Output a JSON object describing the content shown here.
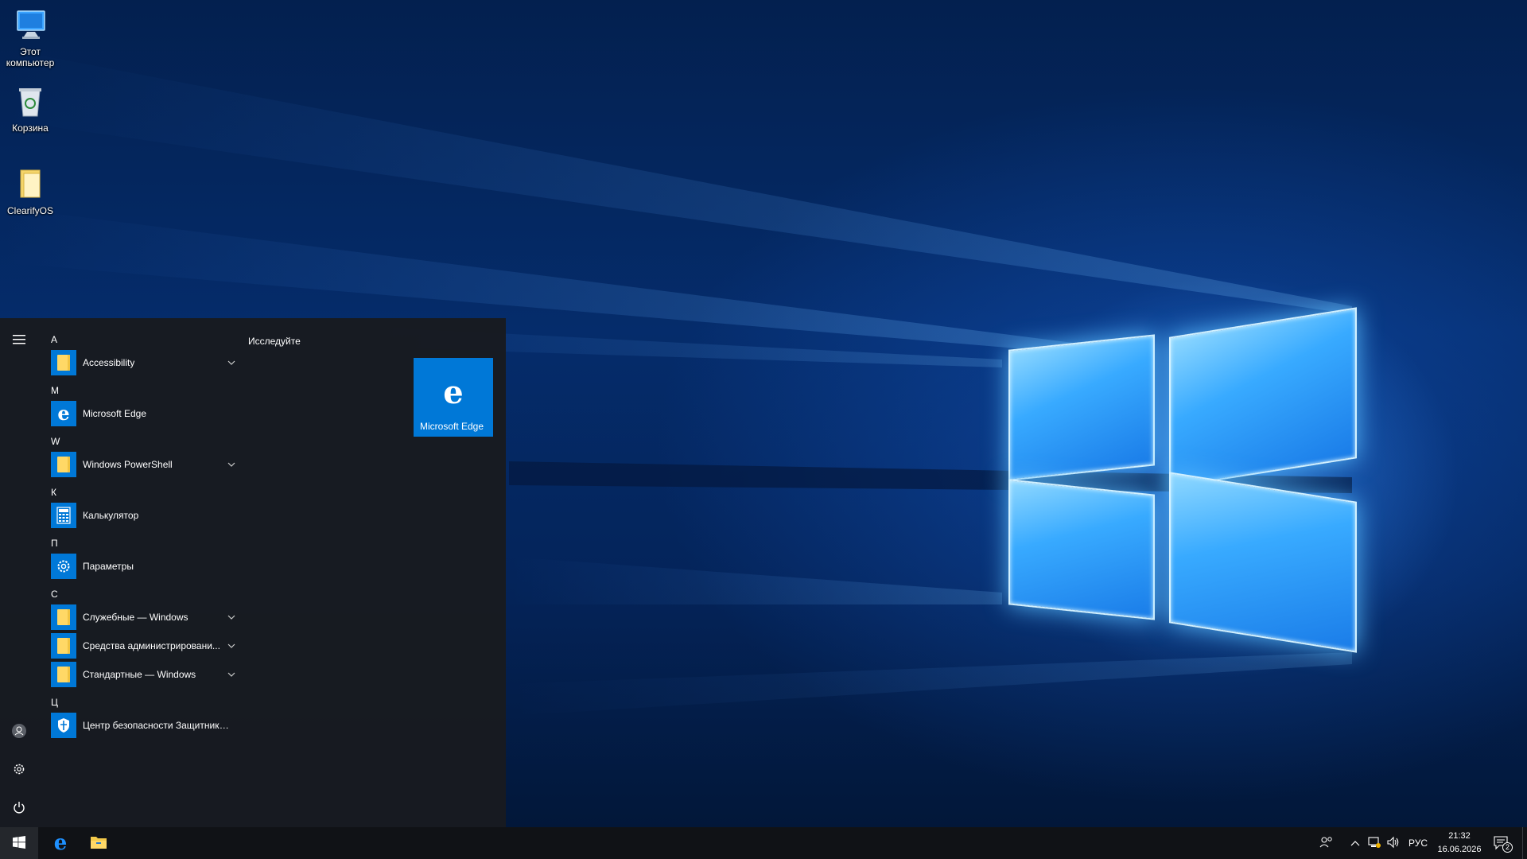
{
  "desktop": {
    "icons": [
      {
        "label": "Этот компьютер",
        "icon": "computer-icon"
      },
      {
        "label": "Корзина",
        "icon": "recycle-bin-icon"
      },
      {
        "label": "ClearifyOS",
        "icon": "folder-icon"
      }
    ]
  },
  "start_menu": {
    "rail": {
      "menu_icon": "hamburger-icon",
      "user_icon": "user-icon",
      "settings_icon": "gear-icon",
      "power_icon": "power-icon"
    },
    "groups": [
      {
        "letter": "A",
        "items": [
          {
            "label": "Accessibility",
            "icon": "folder-icon",
            "expandable": true
          }
        ]
      },
      {
        "letter": "M",
        "items": [
          {
            "label": "Microsoft Edge",
            "icon": "edge-icon",
            "expandable": false
          }
        ]
      },
      {
        "letter": "W",
        "items": [
          {
            "label": "Windows PowerShell",
            "icon": "folder-icon",
            "expandable": true
          }
        ]
      },
      {
        "letter": "К",
        "items": [
          {
            "label": "Калькулятор",
            "icon": "calculator-icon",
            "expandable": false
          }
        ]
      },
      {
        "letter": "П",
        "items": [
          {
            "label": "Параметры",
            "icon": "gear-icon",
            "expandable": false
          }
        ]
      },
      {
        "letter": "С",
        "items": [
          {
            "label": "Служебные — Windows",
            "icon": "folder-icon",
            "expandable": true
          },
          {
            "label": "Средства администрировани...",
            "icon": "folder-icon",
            "expandable": true
          },
          {
            "label": "Стандартные — Windows",
            "icon": "folder-icon",
            "expandable": true
          }
        ]
      },
      {
        "letter": "Ц",
        "items": [
          {
            "label": "Центр безопасности Защитника...",
            "icon": "shield-icon",
            "expandable": false
          }
        ]
      }
    ],
    "tiles_header": "Исследуйте",
    "tiles": [
      {
        "label": "Microsoft Edge",
        "icon": "edge-icon",
        "color": "#0078d7"
      }
    ]
  },
  "taskbar": {
    "start_icon": "windows-logo-icon",
    "pinned": [
      {
        "name": "Microsoft Edge",
        "icon": "edge-icon"
      },
      {
        "name": "File Explorer",
        "icon": "file-explorer-icon"
      }
    ],
    "tray": {
      "people_icon": "people-icon",
      "chevron_icon": "chevron-up-icon",
      "network_icon": "network-icon",
      "volume_icon": "volume-icon",
      "language": "РУС",
      "time": "21:32",
      "date": "16.06.2026",
      "notifications_count": "2"
    }
  },
  "colors": {
    "accent": "#0078d7",
    "menu_bg": "#181b20",
    "taskbar_bg": "#101216"
  }
}
